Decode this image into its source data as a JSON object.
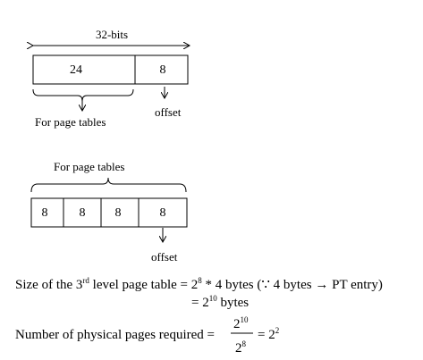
{
  "diagram1": {
    "width_label": "32-bits",
    "fields": [
      "24",
      "8"
    ],
    "brace_label": "For page tables",
    "offset_label": "offset"
  },
  "diagram2": {
    "brace_label": "For page tables",
    "fields": [
      "8",
      "8",
      "8",
      "8"
    ],
    "offset_label": "offset"
  },
  "calc": {
    "line1": {
      "prefix": "Size of the 3",
      "ordinal_sup": "rd",
      "middle": " level page table = 2",
      "exp1": "8",
      "rest": " * 4 bytes (∵ 4 bytes → PT entry)"
    },
    "line2": {
      "prefix": "= 2",
      "exp": "10",
      "suffix": " bytes"
    },
    "line3": {
      "label": "Number of physical pages required =",
      "numerator_base": "2",
      "numerator_exp": "10",
      "denominator_base": "2",
      "denominator_exp": "8",
      "result_prefix": "= 2",
      "result_exp": "2"
    }
  }
}
